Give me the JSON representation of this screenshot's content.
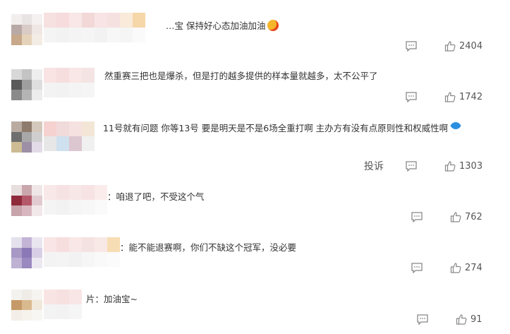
{
  "colors": {
    "text": "#333333",
    "action_icon": "#888888",
    "count": "#555555"
  },
  "comments": [
    {
      "text": "…宝 保持好心态加油加油",
      "emoji": "heart-kiss-emoji",
      "likes": "2404",
      "reply_icon": "comment-icon",
      "like_icon": "thumbs-up-icon"
    },
    {
      "text": "然重赛三把也是爆杀，但是打的越多提供的样本量就越多，太不公平了",
      "likes": "1742",
      "reply_icon": "comment-icon",
      "like_icon": "thumbs-up-icon"
    },
    {
      "text": "11号就有问题 你等13号 要是明天是不是6场全重打啊 主办方有没有点原则性和权威性啊",
      "emoji": "doraemon-emoji",
      "report_label": "投诉",
      "likes": "1303",
      "reply_icon": "comment-icon",
      "like_icon": "thumbs-up-icon"
    },
    {
      "text": "：咱退了吧，不受这个气",
      "likes": "762",
      "reply_icon": "comment-icon",
      "like_icon": "thumbs-up-icon"
    },
    {
      "text": "：能不能退赛啊，你们不缺这个冠军，没必要",
      "likes": "274",
      "reply_icon": "comment-icon",
      "like_icon": "thumbs-up-icon"
    },
    {
      "text": "片：加油宝~",
      "likes": "91",
      "reply_icon": "comment-icon",
      "like_icon": "thumbs-up-icon"
    }
  ]
}
